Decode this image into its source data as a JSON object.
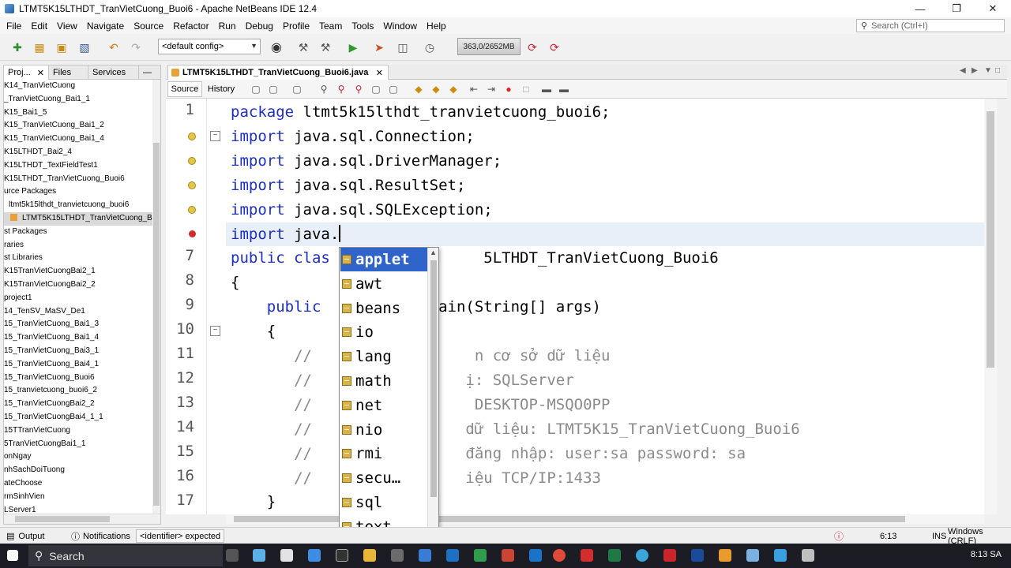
{
  "window": {
    "title": "LTMT5K15LTHDT_TranVietCuong_Buoi6 - Apache NetBeans IDE 12.4",
    "minimize": "—",
    "maximize": "❐",
    "close": "✕"
  },
  "menu": [
    "File",
    "Edit",
    "View",
    "Navigate",
    "Source",
    "Refactor",
    "Run",
    "Debug",
    "Profile",
    "Team",
    "Tools",
    "Window",
    "Help"
  ],
  "search": {
    "placeholder": "Search (Ctrl+I)"
  },
  "toolbar": {
    "config_value": "<default config>",
    "memory": "363,0/2652MB"
  },
  "left_panel": {
    "tabs": [
      {
        "label": "Proj...",
        "close": "✕"
      },
      {
        "label": "Files",
        "close": ""
      },
      {
        "label": "Services",
        "close": ""
      }
    ],
    "minimize": "—",
    "tree": [
      "K14_TranVietCuong",
      "_TranVietCuong_Bai1_1",
      "K15_Bai1_5",
      "K15_TranVietCuong_Bai1_2",
      "K15_TranVietCuong_Bai1_4",
      "K15LTHDT_Bai2_4",
      "K15LTHDT_TextFieldTest1",
      "K15LTHDT_TranVietCuong_Buoi6",
      "urce Packages",
      "ltmt5k15lthdt_tranvietcuong_buoi6",
      "LTMT5K15LTHDT_TranVietCuong_Bu",
      "st Packages",
      "raries",
      "st Libraries",
      "K15TranVietCuongBai2_1",
      "K15TranVietCuongBai2_2",
      "project1",
      "14_TenSV_MaSV_De1",
      "15_TranVietCuong_Bai1_3",
      "15_TranVietCuong_Bai1_4",
      "15_TranVietCuong_Bai3_1",
      "15_TranVietCuong_Bai4_1",
      "15_TranVietCuong_Buoi6",
      "15_tranvietcuong_buoi6_2",
      "15_TranVietCuongBai2_2",
      "15_TranVietCuongBai4_1_1",
      "15TTranVietCuong",
      "5TranVietCuongBai1_1",
      "onNgay",
      "nhSachDoiTuong",
      "ateChoose",
      "rmSinhVien",
      "LServer1"
    ]
  },
  "editor": {
    "file_tab": "LTMT5K15LTHDT_TranVietCuong_Buoi6.java",
    "file_tab_close": "✕",
    "source_tab": "Source",
    "history_tab": "History",
    "line_numbers": [
      "1",
      "",
      "",
      "",
      "",
      "",
      "7",
      "8",
      "9",
      "10",
      "11",
      "12",
      "13",
      "14",
      "15",
      "16",
      "17"
    ],
    "lines": [
      {
        "kw": "package",
        "rest": " ltmt5k15lthdt_tranvietcuong_buoi6;"
      },
      {
        "kw": "import",
        "rest": " java.sql.Connection;"
      },
      {
        "kw": "import",
        "rest": " java.sql.DriverManager;"
      },
      {
        "kw": "import",
        "rest": " java.sql.ResultSet;"
      },
      {
        "kw": "import",
        "rest": " java.sql.SQLException;"
      },
      {
        "kw": "import",
        "rest": " java."
      },
      {
        "kw": "public clas",
        "rest": "                 5LTHDT_TranVietCuong_Buoi6"
      },
      {
        "kw": "",
        "rest": "{"
      },
      {
        "kw": "    public",
        "rest": "         id main(String[] args)"
      },
      {
        "kw": "",
        "rest": "    {"
      },
      {
        "kw": "",
        "rest": "",
        "cm": "       //                  n cơ sở dữ liệu"
      },
      {
        "kw": "",
        "rest": "",
        "cm": "       //                 ị: SQLServer"
      },
      {
        "kw": "",
        "rest": "",
        "cm": "       //                  DESKTOP-MSQO0PP"
      },
      {
        "kw": "",
        "rest": "",
        "cm": "       //                 dữ liệu: LTMT5K15_TranVietCuong_Buoi6"
      },
      {
        "kw": "",
        "rest": "",
        "cm": "       //                 đăng nhập: user:sa password: sa"
      },
      {
        "kw": "",
        "rest": "",
        "cm": "       //                 iệu TCP/IP:1433"
      },
      {
        "kw": "",
        "rest": "    }"
      }
    ]
  },
  "autocomplete": {
    "items": [
      "applet",
      "awt",
      "beans",
      "io",
      "lang",
      "math",
      "net",
      "nio",
      "rmi",
      "secu…",
      "sql",
      "text"
    ],
    "selected": "applet"
  },
  "status": {
    "output_label": "Output",
    "notifications_label": "Notifications",
    "message": "<identifier> expected",
    "position": "6:13",
    "mode": "INS",
    "line_ending": "Windows (CRLF)"
  },
  "taskbar": {
    "search_label": "Search",
    "clock": "8:13 SA"
  }
}
